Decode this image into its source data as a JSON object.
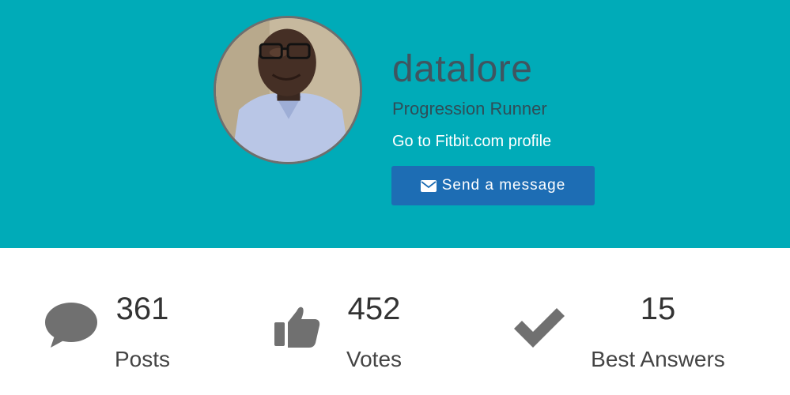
{
  "profile": {
    "username": "datalore",
    "rank": "Progression Runner",
    "profile_link": "Go to Fitbit.com profile",
    "message_button": "Send a message",
    "header_color": "#00abb8",
    "button_color": "#1d6db4"
  },
  "stats": [
    {
      "value": "361",
      "label": "Posts",
      "icon": "speech-bubble-icon"
    },
    {
      "value": "452",
      "label": "Votes",
      "icon": "thumbs-up-icon"
    },
    {
      "value": "15",
      "label": "Best Answers",
      "icon": "checkmark-icon"
    }
  ]
}
